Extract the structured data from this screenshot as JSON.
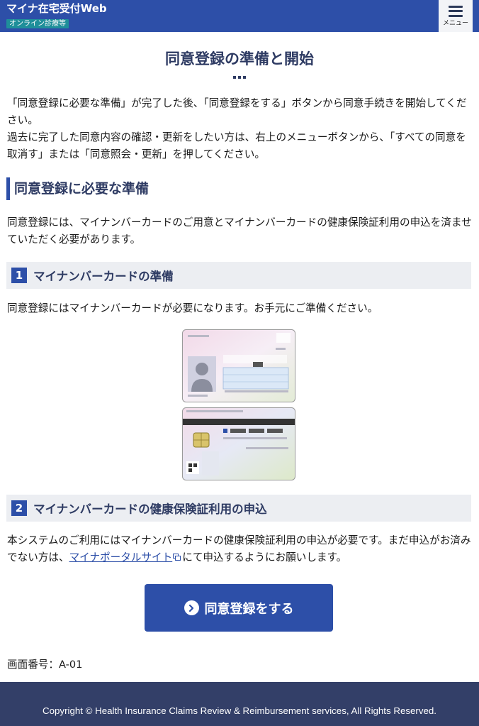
{
  "header": {
    "app_title": "マイナ在宅受付Web",
    "app_subtitle": "オンライン診療等",
    "menu_label": "メニュー"
  },
  "page": {
    "title": "同意登録の準備と開始",
    "intro_line1": "「同意登録に必要な準備」が完了した後、「同意登録をする」ボタンから同意手続きを開始してください。",
    "intro_line2": "過去に完了した同意内容の確認・更新をしたい方は、右上のメニューボタンから、「すべての同意を取消す」または「同意照会・更新」を押してください。"
  },
  "section": {
    "heading": "同意登録に必要な準備",
    "description": "同意登録には、マイナンバーカードのご用意とマイナンバーカードの健康保険証利用の申込を済ませていただく必要があります。"
  },
  "steps": [
    {
      "number": "1",
      "title": "マイナンバーカードの準備",
      "text": "同意登録にはマイナンバーカードが必要になります。お手元にご準備ください。"
    },
    {
      "number": "2",
      "title": "マイナンバーカードの健康保険証利用の申込",
      "text_before": "本システムのご利用にはマイナンバーカードの健康保険証利用の申込が必要です。まだ申込がお済みでない方は、",
      "link": "マイナポータルサイト",
      "text_after": "にて申込するようにお願いします。"
    }
  ],
  "cta": {
    "label": "同意登録をする"
  },
  "screen_number": "画面番号：A-01",
  "footer": {
    "copyright": "Copyright © Health Insurance Claims Review & Reimbursement services, All Rights Reserved."
  },
  "colors": {
    "primary": "#2d4fa8",
    "heading": "#2e3b63",
    "footer": "#333f68",
    "badge": "#1f8f9a"
  },
  "icons": [
    "hamburger-menu-icon",
    "external-link-icon",
    "chevron-right-circle-icon"
  ]
}
